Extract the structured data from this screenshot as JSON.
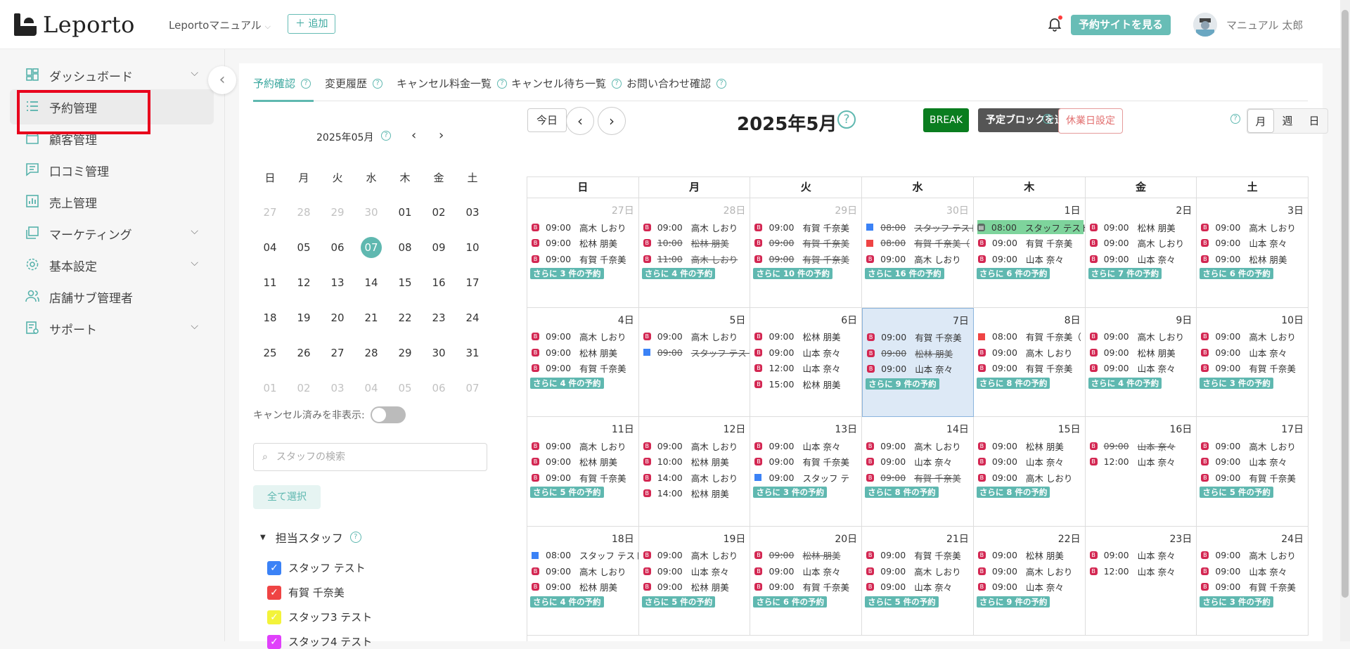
{
  "header": {
    "logo_text": "Leporto",
    "store_select": "Leportoマニュアル",
    "add_label": "追加",
    "site_button": "予約サイトを見る",
    "user_name": "マニュアル 太郎"
  },
  "sidebar": {
    "items": [
      {
        "label": "ダッシュボード",
        "icon": "dashboard-icon",
        "chevron": true
      },
      {
        "label": "予約管理",
        "icon": "list-icon",
        "chevron": false,
        "active": true
      },
      {
        "label": "顧客管理",
        "icon": "store-icon",
        "chevron": false
      },
      {
        "label": "口コミ管理",
        "icon": "chat-icon",
        "chevron": false
      },
      {
        "label": "売上管理",
        "icon": "bar-chart-icon",
        "chevron": false
      },
      {
        "label": "マーケティング",
        "icon": "layers-icon",
        "chevron": true
      },
      {
        "label": "基本設定",
        "icon": "gear-icon",
        "chevron": true
      },
      {
        "label": "店舗サブ管理者",
        "icon": "users-icon",
        "chevron": false
      },
      {
        "label": "サポート",
        "icon": "report-icon",
        "chevron": true
      }
    ]
  },
  "tabs": [
    "予約確認",
    "変更履歴",
    "キャンセル料金一覧",
    "キャンセル待ち一覧",
    "お問い合わせ確認"
  ],
  "mini_calendar": {
    "title": "2025年05月",
    "dow": [
      "日",
      "月",
      "火",
      "水",
      "木",
      "金",
      "土"
    ],
    "weeks": [
      [
        "27",
        "28",
        "29",
        "30",
        "01",
        "02",
        "03"
      ],
      [
        "04",
        "05",
        "06",
        "07",
        "08",
        "09",
        "10"
      ],
      [
        "11",
        "12",
        "13",
        "14",
        "15",
        "16",
        "17"
      ],
      [
        "18",
        "19",
        "20",
        "21",
        "22",
        "23",
        "24"
      ],
      [
        "25",
        "26",
        "27",
        "28",
        "29",
        "30",
        "31"
      ],
      [
        "01",
        "02",
        "03",
        "04",
        "05",
        "06",
        "07"
      ]
    ],
    "today": "07"
  },
  "filters": {
    "hide_cancelled_label": "キャンセル済みを非表示:",
    "search_placeholder": "スタッフの検索",
    "select_all": "全て選択",
    "staff_heading": "担当スタッフ",
    "staff": [
      {
        "name": "スタッフ テスト",
        "color": "#3b82f6"
      },
      {
        "name": "有賀 千奈美",
        "color": "#ef4444"
      },
      {
        "name": "スタッフ3 テスト",
        "color": "#f3f33a"
      },
      {
        "name": "スタッフ4 テスト",
        "color": "#e040fb"
      }
    ]
  },
  "calendar": {
    "today_label": "今日",
    "title": "2025年5月",
    "break_label": "BREAK",
    "block_label": "予定ブロックを追加",
    "holiday_label": "休業日設定",
    "views": [
      "月",
      "週",
      "日"
    ],
    "dow": [
      "日",
      "月",
      "火",
      "水",
      "木",
      "金",
      "土"
    ],
    "weeks": [
      [
        {
          "d": "27日",
          "muted": true,
          "ev": [
            [
              "b",
              "09:00",
              "高木 しおり",
              0
            ],
            [
              "b",
              "09:00",
              "松林 朋美",
              0
            ],
            [
              "b",
              "09:00",
              "有賀 千奈美",
              0
            ]
          ],
          "more": "さらに 3 件の予約"
        },
        {
          "d": "28日",
          "muted": true,
          "ev": [
            [
              "b",
              "09:00",
              "高木 しおり",
              0
            ],
            [
              "b",
              "10:00",
              "松林 朋美",
              1
            ],
            [
              "b",
              "11:00",
              "高木 しおり",
              1
            ]
          ],
          "more": "さらに 4 件の予約"
        },
        {
          "d": "29日",
          "muted": true,
          "ev": [
            [
              "b",
              "09:00",
              "有賀 千奈美",
              0
            ],
            [
              "b",
              "09:00",
              "有賀 千奈美",
              1
            ],
            [
              "b",
              "09:00",
              "有賀 千奈美",
              1
            ]
          ],
          "more": "さらに 10 件の予約"
        },
        {
          "d": "30日",
          "muted": true,
          "ev": [
            [
              "blue",
              "08:00",
              "スタッフ テスト",
              1
            ],
            [
              "red",
              "08:00",
              "有賀 千奈美（",
              1
            ],
            [
              "b",
              "09:00",
              "高木 しおり",
              0
            ]
          ],
          "more": "さらに 16 件の予約"
        },
        {
          "d": "1日",
          "ev": [
            [
              "hl",
              "08:00",
              "スタッフ テスト",
              0
            ],
            [
              "b",
              "09:00",
              "有賀 千奈美",
              0
            ],
            [
              "b",
              "09:00",
              "山本 奈々",
              0
            ]
          ],
          "more": "さらに 6 件の予約"
        },
        {
          "d": "2日",
          "ev": [
            [
              "b",
              "09:00",
              "松林 朋美",
              0
            ],
            [
              "b",
              "09:00",
              "高木 しおり",
              0
            ],
            [
              "b",
              "09:00",
              "山本 奈々",
              0
            ]
          ],
          "more": "さらに 7 件の予約"
        },
        {
          "d": "3日",
          "ev": [
            [
              "b",
              "09:00",
              "高木 しおり",
              0
            ],
            [
              "b",
              "09:00",
              "山本 奈々",
              0
            ],
            [
              "b",
              "09:00",
              "松林 朋美",
              0
            ]
          ],
          "more": "さらに 6 件の予約"
        }
      ],
      [
        {
          "d": "4日",
          "ev": [
            [
              "b",
              "09:00",
              "高木 しおり",
              0
            ],
            [
              "b",
              "09:00",
              "松林 朋美",
              0
            ],
            [
              "b",
              "09:00",
              "有賀 千奈美",
              0
            ]
          ],
          "more": "さらに 4 件の予約"
        },
        {
          "d": "5日",
          "ev": [
            [
              "b",
              "09:00",
              "高木 しおり",
              0
            ],
            [
              "blue",
              "09:00",
              "スタッフ テスト",
              1
            ]
          ],
          "more": ""
        },
        {
          "d": "6日",
          "ev": [
            [
              "b",
              "09:00",
              "松林 朋美",
              0
            ],
            [
              "b",
              "09:00",
              "山本 奈々",
              0
            ],
            [
              "b",
              "12:00",
              "山本 奈々",
              0
            ],
            [
              "b",
              "15:00",
              "松林 朋美",
              0
            ]
          ],
          "more": ""
        },
        {
          "d": "7日",
          "sel": true,
          "ev": [
            [
              "b",
              "09:00",
              "有賀 千奈美",
              0
            ],
            [
              "b",
              "09:00",
              "松林 朋美",
              1
            ],
            [
              "b",
              "09:00",
              "山本 奈々",
              0
            ]
          ],
          "more": "さらに 9 件の予約"
        },
        {
          "d": "8日",
          "ev": [
            [
              "red",
              "08:00",
              "有賀 千奈美（",
              0
            ],
            [
              "b",
              "09:00",
              "高木 しおり",
              0
            ],
            [
              "b",
              "09:00",
              "有賀 千奈美",
              0
            ]
          ],
          "more": "さらに 8 件の予約"
        },
        {
          "d": "9日",
          "ev": [
            [
              "b",
              "09:00",
              "高木 しおり",
              0
            ],
            [
              "b",
              "09:00",
              "松林 朋美",
              0
            ],
            [
              "b",
              "09:00",
              "山本 奈々",
              0
            ]
          ],
          "more": "さらに 4 件の予約"
        },
        {
          "d": "10日",
          "ev": [
            [
              "b",
              "09:00",
              "高木 しおり",
              0
            ],
            [
              "b",
              "09:00",
              "山本 奈々",
              0
            ],
            [
              "b",
              "09:00",
              "有賀 千奈美",
              0
            ]
          ],
          "more": "さらに 3 件の予約"
        }
      ],
      [
        {
          "d": "11日",
          "ev": [
            [
              "b",
              "09:00",
              "高木 しおり",
              0
            ],
            [
              "b",
              "09:00",
              "松林 朋美",
              0
            ],
            [
              "b",
              "09:00",
              "有賀 千奈美",
              0
            ]
          ],
          "more": "さらに 5 件の予約"
        },
        {
          "d": "12日",
          "ev": [
            [
              "b",
              "09:00",
              "高木 しおり",
              0
            ],
            [
              "b",
              "10:00",
              "松林 朋美",
              0
            ],
            [
              "b",
              "14:00",
              "高木 しおり",
              0
            ],
            [
              "b",
              "14:00",
              "松林 朋美",
              0
            ]
          ],
          "more": ""
        },
        {
          "d": "13日",
          "ev": [
            [
              "b",
              "09:00",
              "山本 奈々",
              0
            ],
            [
              "b",
              "09:00",
              "有賀 千奈美",
              0
            ],
            [
              "blue",
              "09:00",
              "スタッフ テ",
              0
            ]
          ],
          "more": "さらに 3 件の予約"
        },
        {
          "d": "14日",
          "ev": [
            [
              "b",
              "09:00",
              "高木 しおり",
              0
            ],
            [
              "b",
              "09:00",
              "山本 奈々",
              0
            ],
            [
              "b",
              "09:00",
              "有賀 千奈美",
              1
            ]
          ],
          "more": "さらに 8 件の予約"
        },
        {
          "d": "15日",
          "ev": [
            [
              "b",
              "09:00",
              "松林 朋美",
              0
            ],
            [
              "b",
              "09:00",
              "山本 奈々",
              0
            ],
            [
              "b",
              "09:00",
              "高木 しおり",
              0
            ]
          ],
          "more": "さらに 8 件の予約"
        },
        {
          "d": "16日",
          "ev": [
            [
              "b",
              "09:00",
              "山本 奈々",
              1
            ],
            [
              "b",
              "12:00",
              "山本 奈々",
              0
            ]
          ],
          "more": ""
        },
        {
          "d": "17日",
          "ev": [
            [
              "b",
              "09:00",
              "高木 しおり",
              0
            ],
            [
              "b",
              "09:00",
              "山本 奈々",
              0
            ],
            [
              "b",
              "09:00",
              "有賀 千奈美",
              0
            ]
          ],
          "more": "さらに 5 件の予約"
        }
      ],
      [
        {
          "d": "18日",
          "ev": [
            [
              "blue",
              "08:00",
              "スタッフ テスト",
              0
            ],
            [
              "b",
              "09:00",
              "高木 しおり",
              0
            ],
            [
              "b",
              "09:00",
              "松林 朋美",
              0
            ]
          ],
          "more": "さらに 4 件の予約"
        },
        {
          "d": "19日",
          "ev": [
            [
              "b",
              "09:00",
              "高木 しおり",
              0
            ],
            [
              "b",
              "09:00",
              "山本 奈々",
              0
            ],
            [
              "b",
              "09:00",
              "松林 朋美",
              0
            ]
          ],
          "more": "さらに 5 件の予約"
        },
        {
          "d": "20日",
          "ev": [
            [
              "b",
              "09:00",
              "松林 朋美",
              1
            ],
            [
              "b",
              "09:00",
              "山本 奈々",
              0
            ],
            [
              "b",
              "09:00",
              "有賀 千奈美",
              0
            ]
          ],
          "more": "さらに 6 件の予約"
        },
        {
          "d": "21日",
          "ev": [
            [
              "b",
              "09:00",
              "有賀 千奈美",
              0
            ],
            [
              "b",
              "09:00",
              "高木 しおり",
              0
            ],
            [
              "b",
              "09:00",
              "山本 奈々",
              0
            ]
          ],
          "more": "さらに 5 件の予約"
        },
        {
          "d": "22日",
          "ev": [
            [
              "b",
              "09:00",
              "松林 朋美",
              0
            ],
            [
              "b",
              "09:00",
              "高木 しおり",
              0
            ],
            [
              "b",
              "09:00",
              "山本 奈々",
              0
            ]
          ],
          "more": "さらに 9 件の予約"
        },
        {
          "d": "23日",
          "ev": [
            [
              "b",
              "09:00",
              "山本 奈々",
              0
            ],
            [
              "b",
              "12:00",
              "山本 奈々",
              0
            ]
          ],
          "more": ""
        },
        {
          "d": "24日",
          "ev": [
            [
              "b",
              "09:00",
              "高木 しおり",
              0
            ],
            [
              "b",
              "09:00",
              "山本 奈々",
              0
            ],
            [
              "b",
              "09:00",
              "有賀 千奈美",
              0
            ]
          ],
          "more": "さらに 3 件の予約"
        }
      ]
    ]
  },
  "colors": {
    "accent": "#5fb8b0",
    "break": "#0a7d1f",
    "badge": "#d32752",
    "highlight_border": "#e8001c"
  }
}
